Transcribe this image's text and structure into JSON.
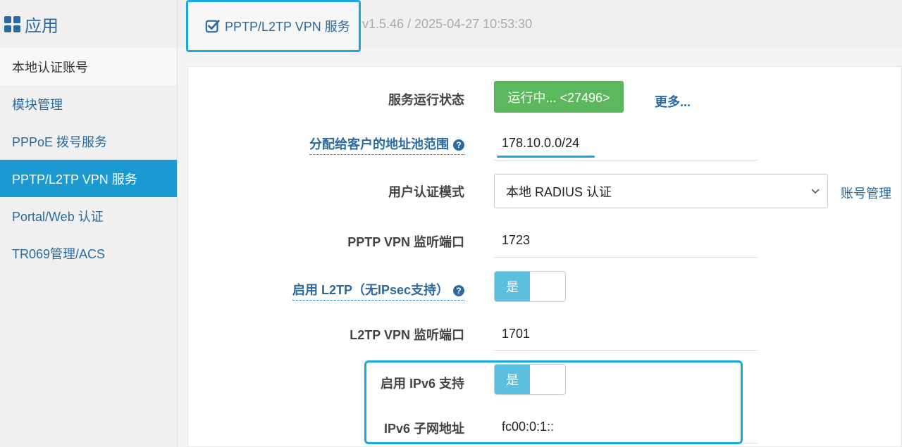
{
  "sidebar": {
    "title": "应用",
    "items": [
      {
        "label": "本地认证账号"
      },
      {
        "label": "模块管理"
      },
      {
        "label": "PPPoE 拨号服务"
      },
      {
        "label": "PPTP/L2TP VPN 服务"
      },
      {
        "label": "Portal/Web 认证"
      },
      {
        "label": "TR069管理/ACS"
      }
    ]
  },
  "header": {
    "tab_label": "PPTP/L2TP VPN 服务",
    "version": "v1.5.46 / 2025-04-27 10:53:30"
  },
  "form": {
    "service_status_label": "服务运行状态",
    "service_status_value": "运行中... <27496>",
    "more_label": "更多...",
    "pool_label": "分配给客户的地址池范围",
    "pool_value": "178.10.0.0/24",
    "auth_mode_label": "用户认证模式",
    "auth_mode_value": "本地 RADIUS 认证",
    "account_mgmt_label": "账号管理",
    "pptp_port_label": "PPTP VPN 监听端口",
    "pptp_port_value": "1723",
    "l2tp_enable_label": "启用 L2TP（无IPsec支持）",
    "l2tp_enable_value": "是",
    "l2tp_port_label": "L2TP VPN 监听端口",
    "l2tp_port_value": "1701",
    "ipv6_enable_label": "启用 IPv6 支持",
    "ipv6_enable_value": "是",
    "ipv6_subnet_label": "IPv6 子网地址",
    "ipv6_subnet_value": "fc00:0:1::"
  },
  "icons": {
    "help": "?"
  },
  "colors": {
    "accent": "#1a9ad0",
    "link": "#2a6aa0",
    "success": "#5cb85c",
    "toggle_on": "#5bc0de"
  }
}
